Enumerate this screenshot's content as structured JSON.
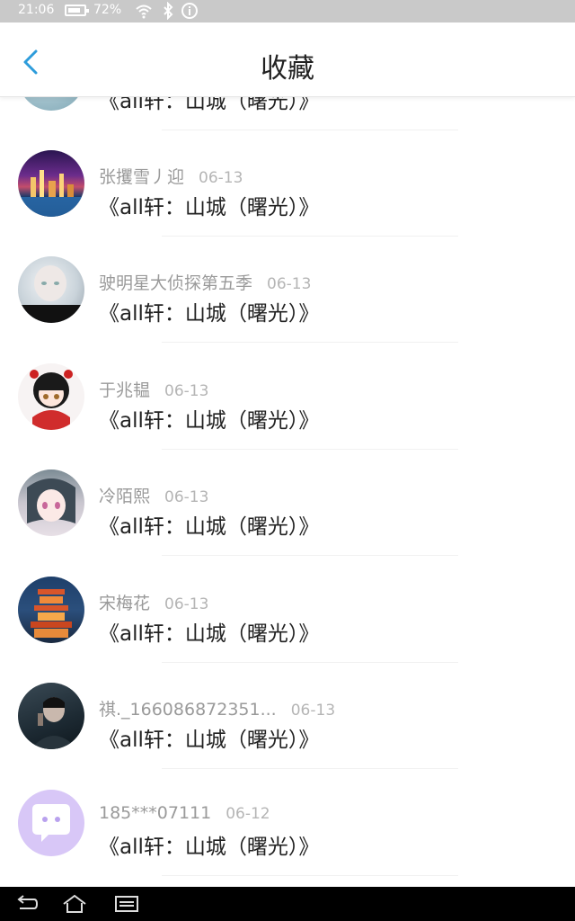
{
  "status": {
    "time": "21:06",
    "battery": "72%"
  },
  "header": {
    "title": "收藏"
  },
  "partial_item": {
    "title": "《all轩：山城（曙光）》"
  },
  "items": [
    {
      "user": "张攫雪丿迎",
      "date": "06-13",
      "title": "《all轩：山城（曙光）》"
    },
    {
      "user": "驶明星大侦探第五季",
      "date": "06-13",
      "title": "《all轩：山城（曙光）》"
    },
    {
      "user": "于兆韫",
      "date": "06-13",
      "title": "《all轩：山城（曙光）》"
    },
    {
      "user": "冷陌熙",
      "date": "06-13",
      "title": "《all轩：山城（曙光）》"
    },
    {
      "user": "宋梅花",
      "date": "06-13",
      "title": "《all轩：山城（曙光）》"
    },
    {
      "user": "祺._166086872351...",
      "date": "06-13",
      "title": "《all轩：山城（曙光）》"
    },
    {
      "user": "185***07111",
      "date": "06-12",
      "title": "《all轩：山城（曙光）》"
    }
  ],
  "colors": {
    "accent": "#2d9cdb",
    "avatar_default": "#d8c7f7"
  }
}
